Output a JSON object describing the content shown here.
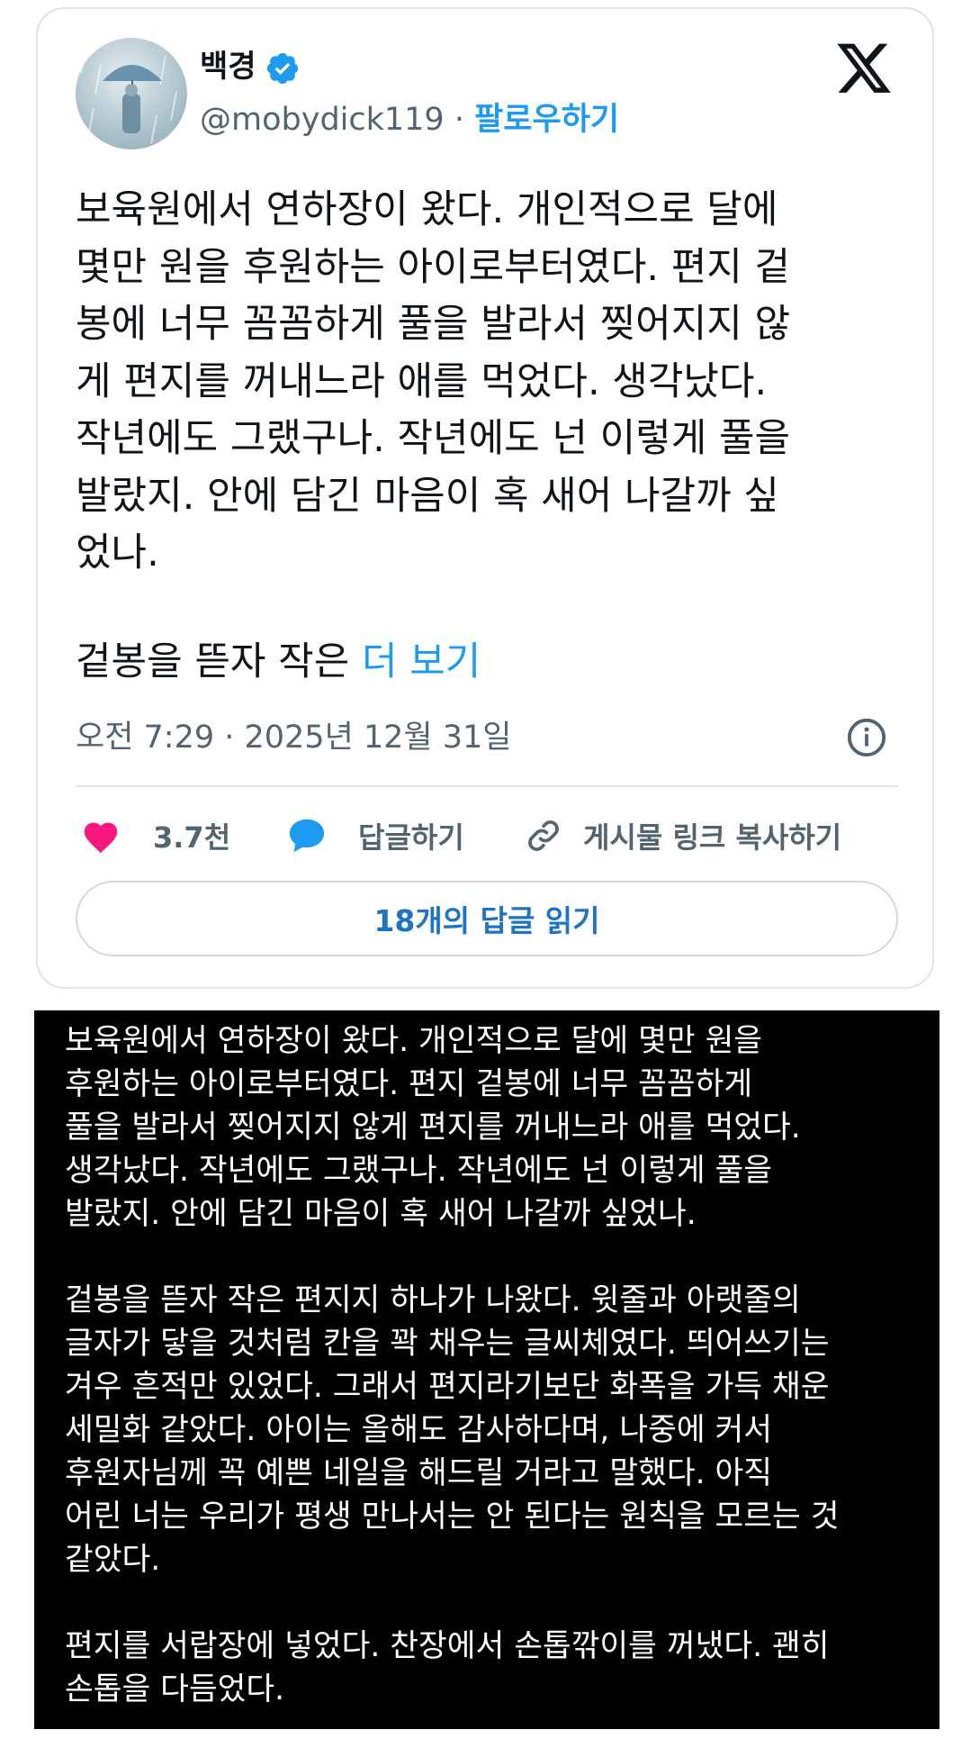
{
  "tweet": {
    "display_name": "백경",
    "handle": "@mobydick119",
    "separator": " · ",
    "follow_label": "팔로우하기",
    "text": "보육원에서 연하장이 왔다. 개인적으로 달에\n몇만 원을 후원하는 아이로부터였다. 편지 겉\n봉에 너무 꼼꼼하게 풀을 발라서 찢어지지 않\n게 편지를 꺼내느라 애를 먹었다. 생각났다.\n작년에도 그랬구나. 작년에도 넌 이렇게 풀을\n발랐지. 안에 담긴 마음이 혹 새어 나갈까 싶\n었나.",
    "text_tail": "겉봉을 뜯자 작은 ",
    "more_label": "더 보기",
    "timestamp": "오전 7:29 · 2025년 12월 31일",
    "like_count": "3.7천",
    "reply_label": "답글하기",
    "copy_link_label": "게시물 링크 복사하기",
    "read_replies_label": "18개의 답글 읽기",
    "icons": {
      "avatar": "avatar-image",
      "verified": "verified-badge-icon",
      "logo": "x-logo-icon",
      "info": "info-icon",
      "like": "heart-icon",
      "reply": "speech-bubble-icon",
      "copy": "link-icon"
    },
    "colors": {
      "accent": "#1d9bf0",
      "like": "#f91880",
      "text": "#0f1419",
      "muted": "#536471"
    }
  },
  "full_text": {
    "body": "보육원에서 연하장이 왔다. 개인적으로 달에 몇만 원을\n후원하는 아이로부터였다. 편지 겉봉에 너무 꼼꼼하게\n풀을 발라서 찢어지지 않게 편지를 꺼내느라 애를 먹었다.\n생각났다. 작년에도 그랬구나. 작년에도 넌 이렇게 풀을\n발랐지. 안에 담긴 마음이 혹 새어 나갈까 싶었나.\n\n겉봉을 뜯자 작은 편지지 하나가 나왔다. 윗줄과 아랫줄의\n글자가 닿을 것처럼 칸을 꽉 채우는 글씨체였다. 띄어쓰기는\n겨우 흔적만 있었다. 그래서 편지라기보단 화폭을 가득 채운\n세밀화 같았다. 아이는 올해도 감사하다며, 나중에 커서\n후원자님께 꼭 예쁜 네일을 해드릴 거라고 말했다. 아직\n어린 너는 우리가 평생 만나서는 안 된다는 원칙을 모르는 것\n같았다.\n\n편지를 서랍장에 넣었다. 찬장에서 손톱깎이를 꺼냈다. 괜히\n손톱을 다듬었다."
  }
}
